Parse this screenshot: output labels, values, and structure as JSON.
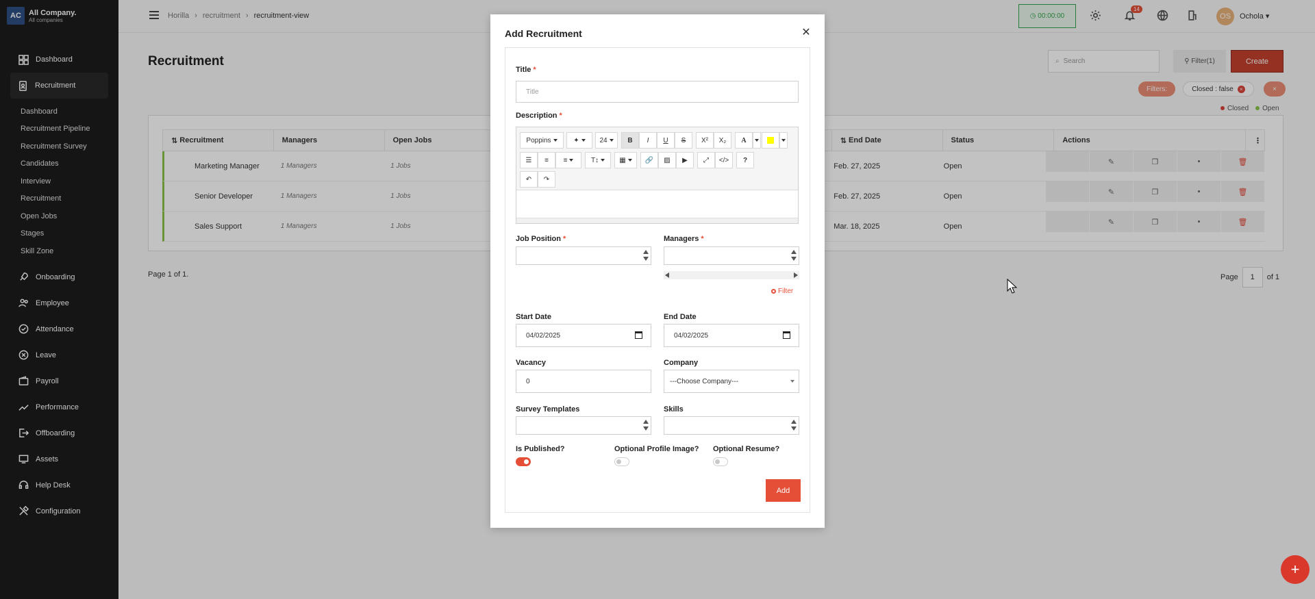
{
  "brand": {
    "logo": "AC",
    "name": "All Company.",
    "sub": "All companies"
  },
  "sidebar": {
    "items": [
      {
        "label": "Dashboard",
        "icon": "dashboard-icon"
      },
      {
        "label": "Recruitment",
        "icon": "recruitment-icon"
      },
      {
        "label": "Onboarding",
        "icon": "rocket-icon"
      },
      {
        "label": "Employee",
        "icon": "people-icon"
      },
      {
        "label": "Attendance",
        "icon": "check-circle-icon"
      },
      {
        "label": "Leave",
        "icon": "leave-icon"
      },
      {
        "label": "Payroll",
        "icon": "wallet-icon"
      },
      {
        "label": "Performance",
        "icon": "chart-line-icon"
      },
      {
        "label": "Offboarding",
        "icon": "exit-icon"
      },
      {
        "label": "Assets",
        "icon": "monitor-icon"
      },
      {
        "label": "Help Desk",
        "icon": "headset-icon"
      },
      {
        "label": "Configuration",
        "icon": "tools-icon"
      }
    ],
    "sub_items": [
      "Dashboard",
      "Recruitment Pipeline",
      "Recruitment Survey",
      "Candidates",
      "Interview",
      "Recruitment",
      "Open Jobs",
      "Stages",
      "Skill Zone"
    ]
  },
  "topbar": {
    "breadcrumbs": [
      "Horilla",
      "recruitment",
      "recruitment-view"
    ],
    "timer": "00:00:00",
    "notifications": "14",
    "avatar_initials": "OS",
    "username": "Ochola"
  },
  "main": {
    "title": "Recruitment",
    "search_placeholder": "Search",
    "filter_label": "Filter(1)",
    "create_label": "Create",
    "filters_label": "Filters:",
    "closed_pill": "Closed : false",
    "legend": {
      "closed": "Closed",
      "open": "Open"
    },
    "columns": [
      "Recruitment",
      "Managers",
      "Open Jobs",
      "End Date",
      "Status",
      "Actions"
    ],
    "rows": [
      {
        "name": "Marketing Manager",
        "managers": "1 Managers",
        "jobs": "1 Jobs",
        "end": "Feb. 27, 2025",
        "status": "Open"
      },
      {
        "name": "Senior Developer",
        "managers": "1 Managers",
        "jobs": "1 Jobs",
        "end": "Feb. 27, 2025",
        "status": "Open"
      },
      {
        "name": "Sales Support",
        "managers": "1 Managers",
        "jobs": "1 Jobs",
        "end": "Mar. 18, 2025",
        "status": "Open"
      }
    ],
    "page_info": "Page 1 of 1.",
    "pager": {
      "label": "Page",
      "current": "1",
      "of": "of 1"
    }
  },
  "modal": {
    "title": "Add Recruitment",
    "title_label": "Title",
    "title_placeholder": "Title",
    "description_label": "Description",
    "toolbar": {
      "font": "Poppins",
      "size": "24"
    },
    "job_position_label": "Job Position",
    "managers_label": "Managers",
    "filter_link": "Filter",
    "start_date_label": "Start Date",
    "start_date": "04/02/2025",
    "end_date_label": "End Date",
    "end_date": "04/02/2025",
    "vacancy_label": "Vacancy",
    "vacancy": "0",
    "company_label": "Company",
    "company_value": "---Choose Company---",
    "survey_label": "Survey Templates",
    "skills_label": "Skills",
    "published_label": "Is Published?",
    "profile_image_label": "Optional Profile Image?",
    "resume_label": "Optional Resume?",
    "add_label": "Add"
  },
  "colors": {
    "accent": "#e54f38",
    "sidebar": "#1c1c1c",
    "open_status": "#8bc34a",
    "closed_status": "#d9453a"
  }
}
